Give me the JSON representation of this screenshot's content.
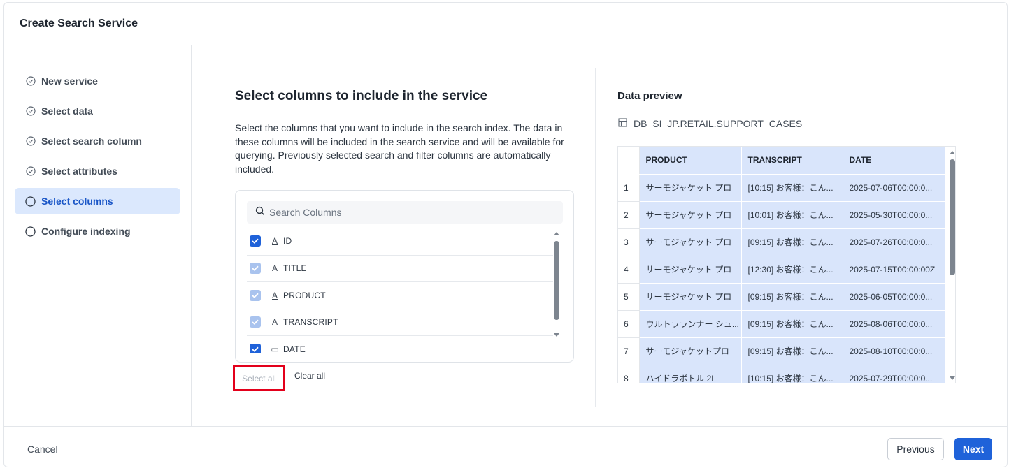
{
  "modal": {
    "title": "Create Search Service"
  },
  "steps": [
    {
      "label": "New service",
      "state": "done"
    },
    {
      "label": "Select data",
      "state": "done"
    },
    {
      "label": "Select search column",
      "state": "done"
    },
    {
      "label": "Select attributes",
      "state": "done"
    },
    {
      "label": "Select columns",
      "state": "active"
    },
    {
      "label": "Configure indexing",
      "state": "pending"
    }
  ],
  "main": {
    "title": "Select columns to include in the service",
    "description": "Select the columns that you want to include in the search index. The data in these columns will be included in the search service and will be available for querying. Previously selected search and filter columns are automatically included.",
    "search_placeholder": "Search Columns",
    "columns": [
      {
        "name": "ID",
        "type": "text",
        "type_glyph": "A",
        "checked": true,
        "disabled": false
      },
      {
        "name": "TITLE",
        "type": "text",
        "type_glyph": "A",
        "checked": true,
        "disabled": true
      },
      {
        "name": "PRODUCT",
        "type": "text",
        "type_glyph": "A",
        "checked": true,
        "disabled": true
      },
      {
        "name": "TRANSCRIPT",
        "type": "text",
        "type_glyph": "A",
        "checked": true,
        "disabled": true
      },
      {
        "name": "DATE",
        "type": "date",
        "type_glyph": "▭",
        "checked": true,
        "disabled": false
      }
    ],
    "select_all_label": "Select all",
    "clear_all_label": "Clear all"
  },
  "preview": {
    "title": "Data preview",
    "source": "DB_SI_JP.RETAIL.SUPPORT_CASES",
    "headers": [
      "PRODUCT",
      "TRANSCRIPT",
      "DATE"
    ],
    "rows": [
      [
        "1",
        "サーモジャケット プロ",
        "[10:15] お客様：こん...",
        "2025-07-06T00:00:0..."
      ],
      [
        "2",
        "サーモジャケット プロ",
        "[10:01] お客様：こん...",
        "2025-05-30T00:00:0..."
      ],
      [
        "3",
        "サーモジャケット プロ",
        "[09:15] お客様：こん...",
        "2025-07-26T00:00:0..."
      ],
      [
        "4",
        "サーモジャケット プロ",
        "[12:30] お客様：こん...",
        "2025-07-15T00:00:00Z"
      ],
      [
        "5",
        "サーモジャケット プロ",
        "[09:15] お客様：こん...",
        "2025-06-05T00:00:0..."
      ],
      [
        "6",
        "ウルトラランナー シュ...",
        "[09:15] お客様：こん...",
        "2025-08-06T00:00:0..."
      ],
      [
        "7",
        "サーモジャケットプロ",
        "[09:15] お客様：こん...",
        "2025-08-10T00:00:0..."
      ],
      [
        "8",
        "ハイドラボトル 2L",
        "[10:15] お客様：こん...",
        "2025-07-29T00:00:0..."
      ]
    ]
  },
  "footer": {
    "cancel": "Cancel",
    "previous": "Previous",
    "next": "Next"
  },
  "colors": {
    "accent": "#1f62d9",
    "active_step_bg": "#dbe8fd",
    "preview_cell_bg": "#d9e5fb",
    "highlight": "#e3001b"
  }
}
